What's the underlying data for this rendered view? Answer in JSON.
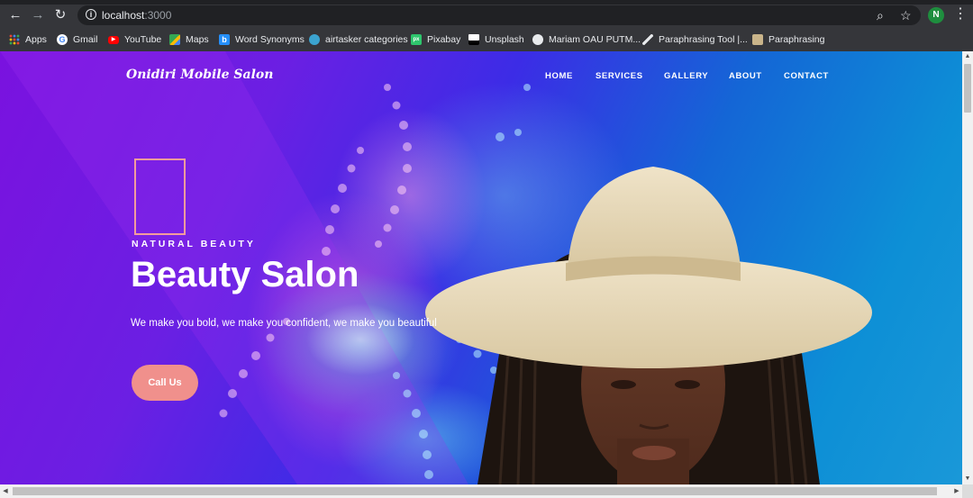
{
  "browser": {
    "url_host": "localhost",
    "url_port": ":3000",
    "profile_initial": "N",
    "bookmarks": [
      {
        "label": "Apps",
        "icon": "apps-grid-icon",
        "color": "#4285f4"
      },
      {
        "label": "Gmail",
        "icon": "google-icon",
        "color": "#ffffff"
      },
      {
        "label": "YouTube",
        "icon": "youtube-icon",
        "color": "#ff0000"
      },
      {
        "label": "Maps",
        "icon": "maps-icon",
        "color": "#34a853"
      },
      {
        "label": "Word Synonyms",
        "icon": "bing-icon",
        "color": "#258ffa"
      },
      {
        "label": "airtasker categories",
        "icon": "edge-icon",
        "color": "#3ba3d0"
      },
      {
        "label": "Pixabay",
        "icon": "pixabay-icon",
        "color": "#2ec66d"
      },
      {
        "label": "Unsplash",
        "icon": "unsplash-icon",
        "color": "#ffffff"
      },
      {
        "label": "Mariam OAU PUTM...",
        "icon": "globe-icon",
        "color": "#e8eaed"
      },
      {
        "label": "Paraphrasing Tool |...",
        "icon": "quill-icon",
        "color": "#e8eaed"
      },
      {
        "label": "Paraphrasing",
        "icon": "image-icon",
        "color": "#c9b48a"
      }
    ]
  },
  "site": {
    "brand": "Onidiri Mobile Salon",
    "nav": [
      "HOME",
      "SERVICES",
      "GALLERY",
      "ABOUT",
      "CONTACT"
    ],
    "eyebrow": "NATURAL BEAUTY",
    "headline": "Beauty Salon",
    "tagline": "We make you bold, we make you confident, we make you beautiful",
    "cta": "Call Us",
    "colors": {
      "accent": "#f0908c",
      "deco_border": "#f39c9c"
    }
  }
}
